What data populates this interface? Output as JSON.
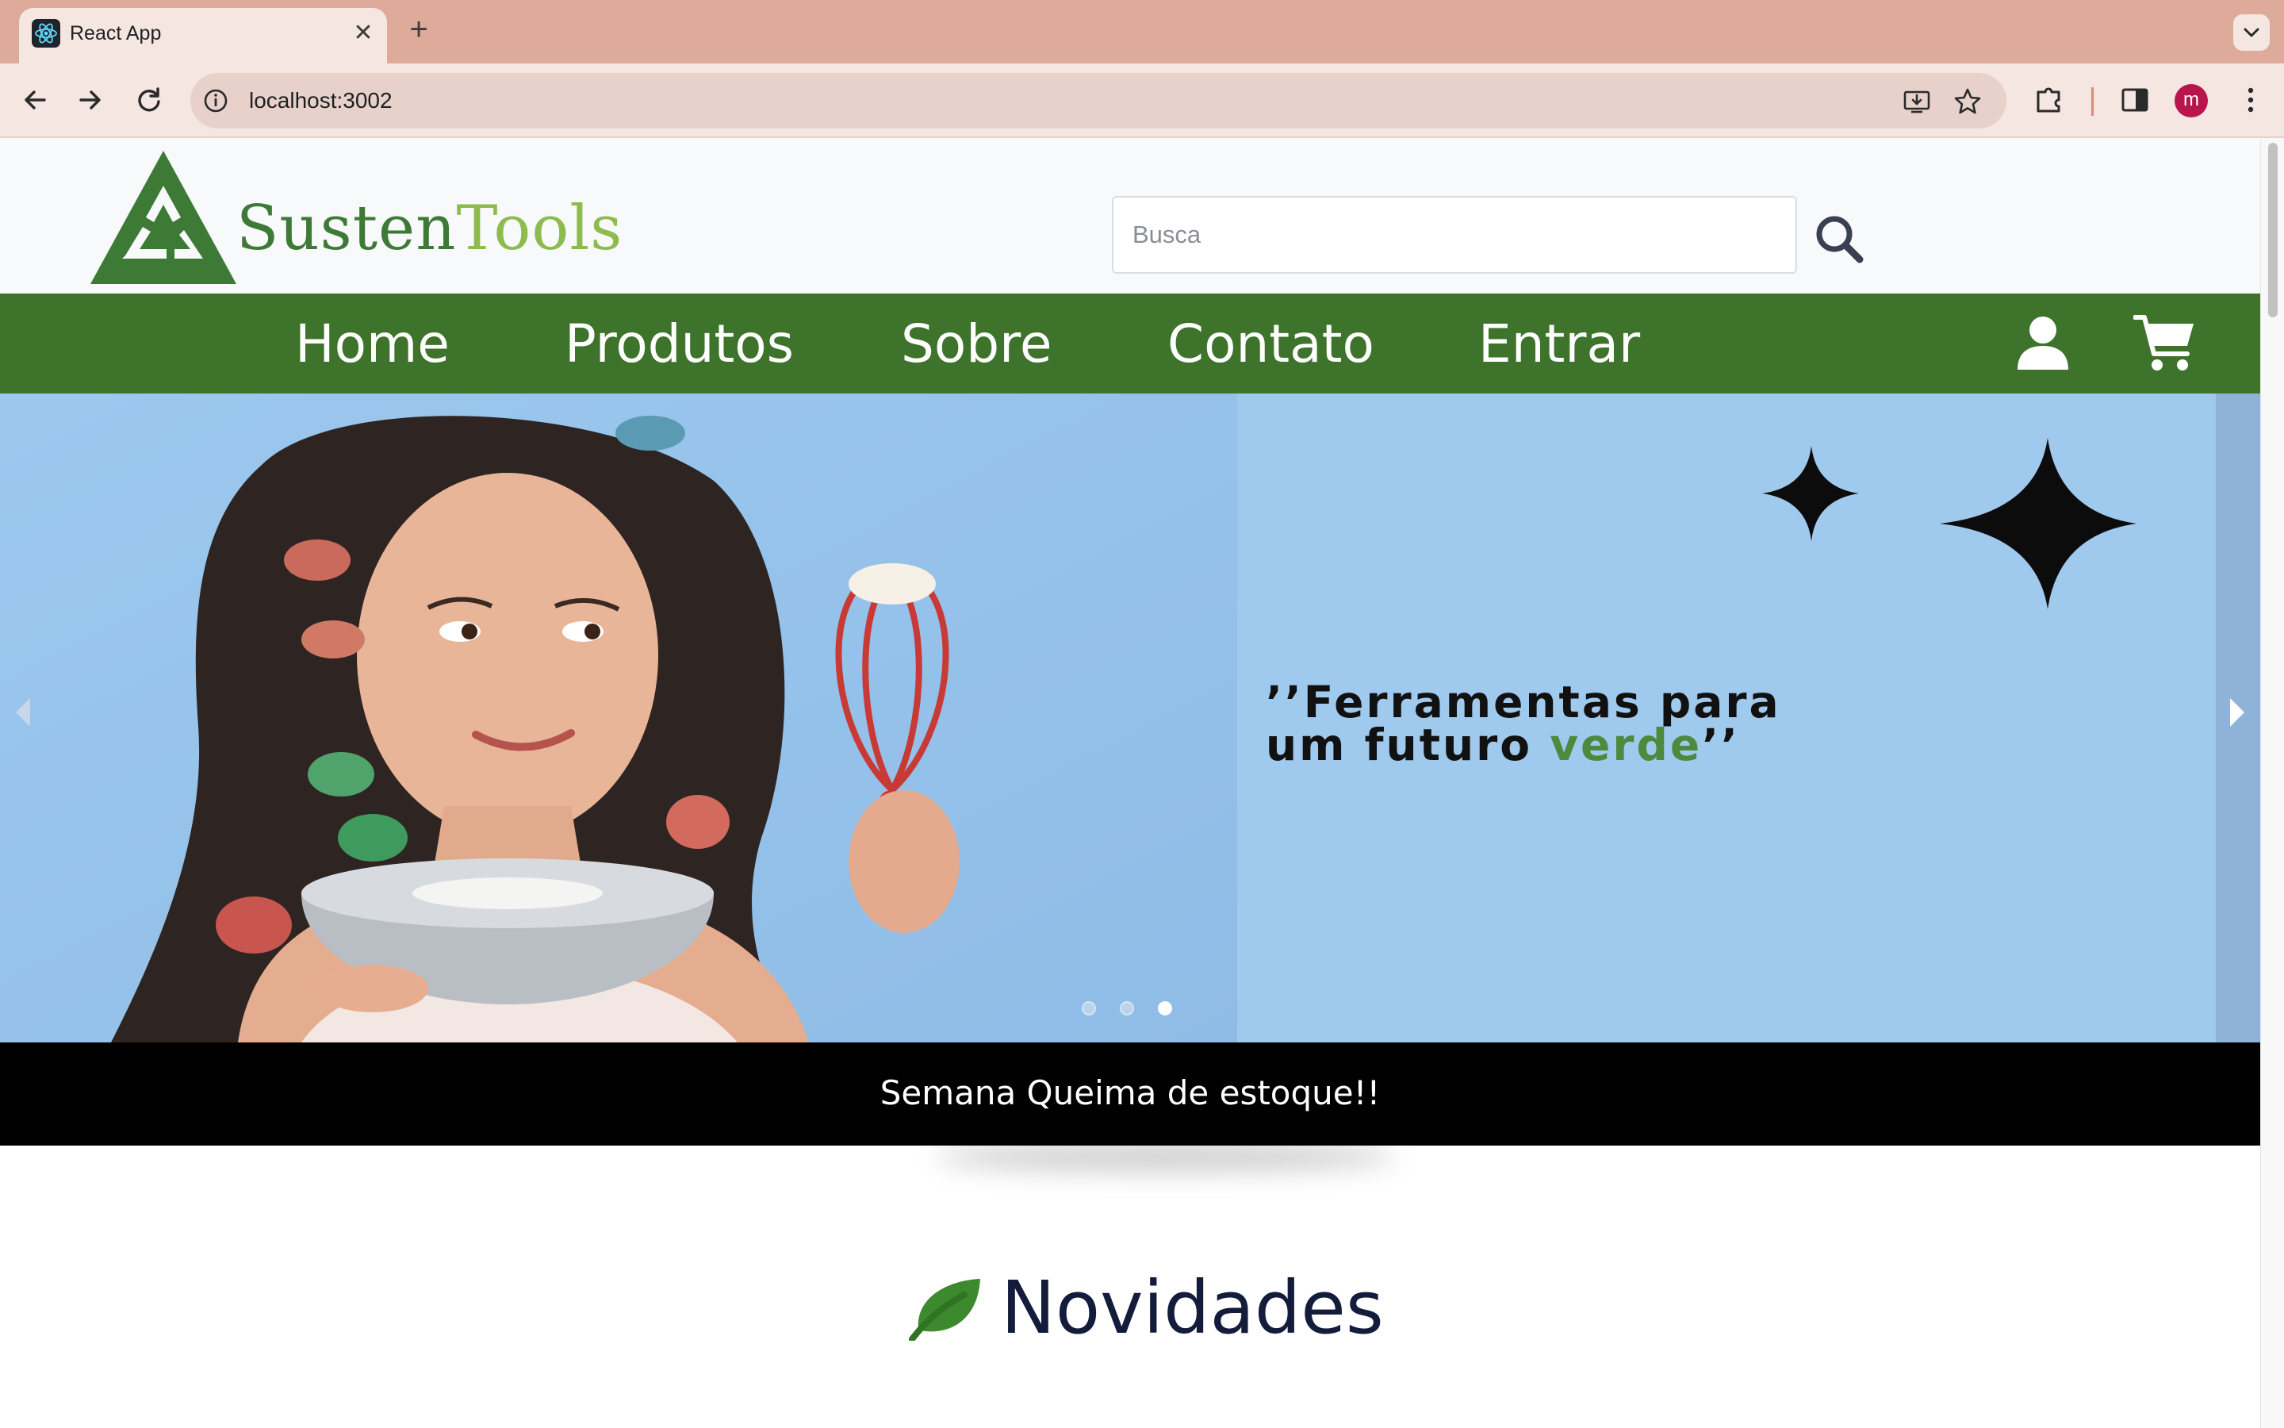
{
  "browser": {
    "tab_title": "React App",
    "tab_close": "✕",
    "new_tab": "+",
    "url": "localhost:3002"
  },
  "site": {
    "logo": {
      "part1": "Susten",
      "part2": "Tools"
    },
    "search": {
      "placeholder": "Busca"
    },
    "nav": {
      "home": "Home",
      "produtos": "Produtos",
      "sobre": "Sobre",
      "contato": "Contato",
      "entrar": "Entrar"
    },
    "hero": {
      "quote_line1": "’’Ferramentas para",
      "quote_line2_start": "um futuro ",
      "quote_line2_highlight": "verde",
      "quote_line2_end": "’’",
      "slide_count": 3,
      "active_slide": 3
    },
    "promo": {
      "text": "Semana Queima de estoque!!"
    },
    "section": {
      "title": "Novidades"
    }
  },
  "colors": {
    "tabbar": "#deaa9a",
    "toolbar": "#f5e6e1",
    "nav_green": "#3d732a",
    "logo_dark_green": "#3d7a36",
    "logo_light_green": "#8dbb4e",
    "hero_blue": "#a0c9ee",
    "promo_black": "#000000",
    "title_navy": "#141c3c"
  },
  "icons": {
    "search": "search-icon",
    "user": "user-icon",
    "cart": "cart-icon",
    "leaf": "leaf-icon"
  }
}
